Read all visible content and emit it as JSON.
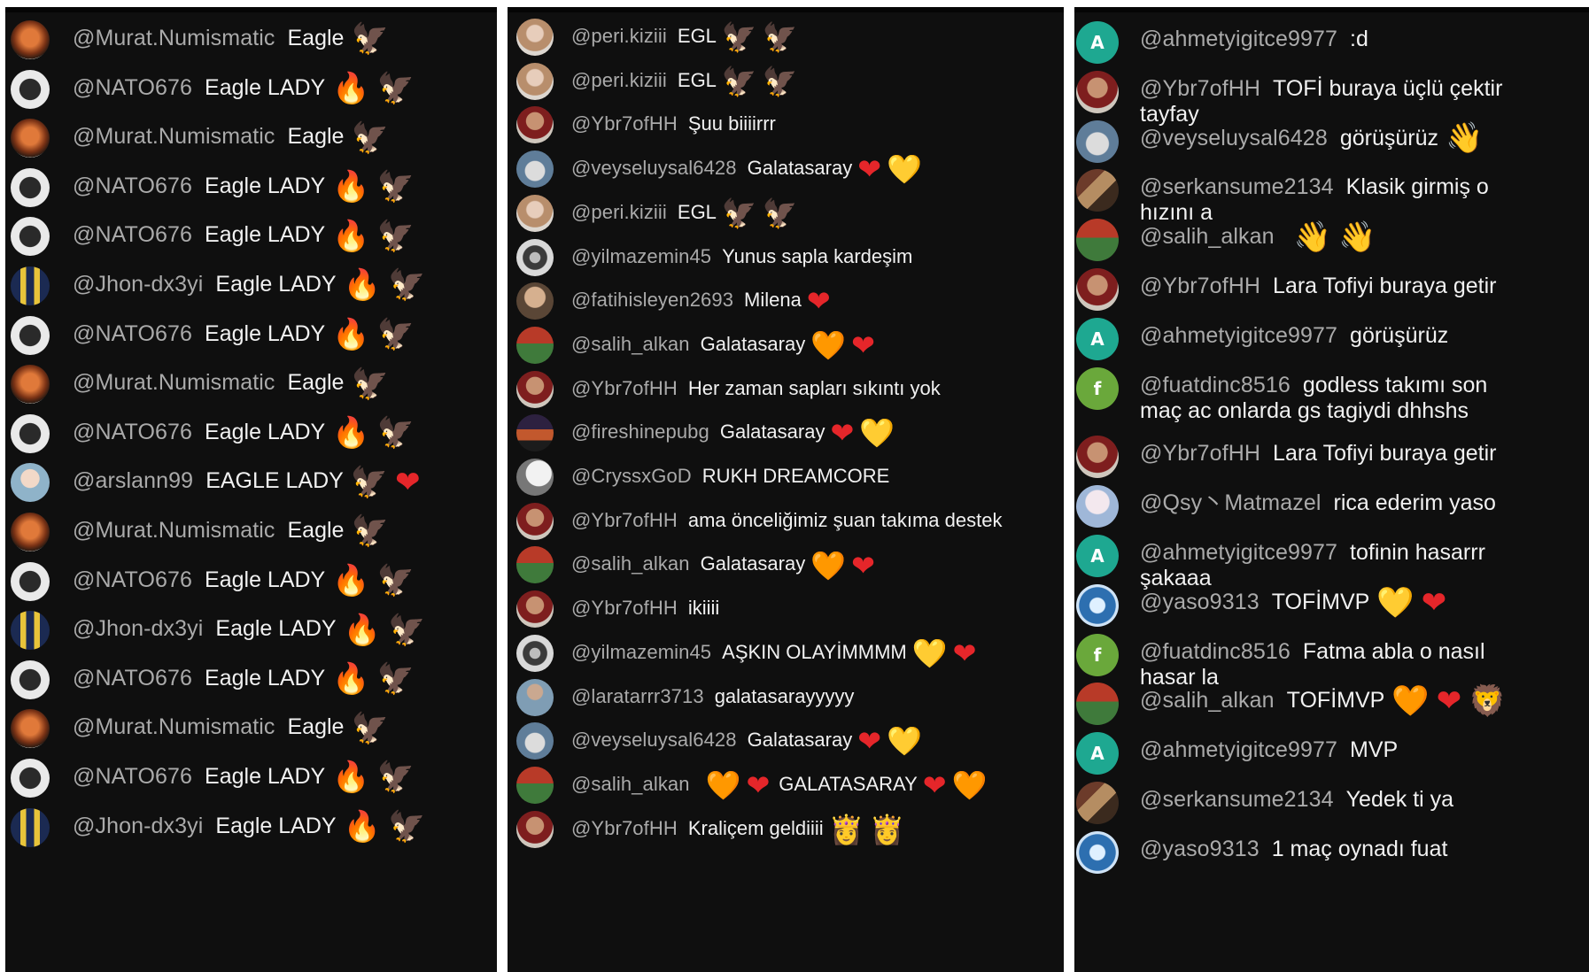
{
  "panels": [
    {
      "rows": [
        {
          "avatar": "murat",
          "user": "@Murat.Numismatic",
          "text": "Eagle",
          "emojis": [
            "eagle"
          ]
        },
        {
          "avatar": "nato",
          "user": "@NATO676",
          "text": "Eagle LADY",
          "emojis": [
            "fire",
            "eagle"
          ]
        },
        {
          "avatar": "murat",
          "user": "@Murat.Numismatic",
          "text": "Eagle",
          "emojis": [
            "eagle"
          ]
        },
        {
          "avatar": "nato",
          "user": "@NATO676",
          "text": "Eagle LADY",
          "emojis": [
            "fire",
            "eagle"
          ]
        },
        {
          "avatar": "nato",
          "user": "@NATO676",
          "text": "Eagle LADY",
          "emojis": [
            "fire",
            "eagle"
          ]
        },
        {
          "avatar": "jhon",
          "user": "@Jhon-dx3yi",
          "text": "Eagle LADY",
          "emojis": [
            "fire",
            "eagle"
          ]
        },
        {
          "avatar": "nato",
          "user": "@NATO676",
          "text": "Eagle LADY",
          "emojis": [
            "fire",
            "eagle"
          ]
        },
        {
          "avatar": "murat",
          "user": "@Murat.Numismatic",
          "text": "Eagle",
          "emojis": [
            "eagle"
          ]
        },
        {
          "avatar": "nato",
          "user": "@NATO676",
          "text": "Eagle LADY",
          "emojis": [
            "fire",
            "eagle"
          ]
        },
        {
          "avatar": "arslan",
          "user": "@arslann99",
          "text": "EAGLE LADY",
          "emojis": [
            "eagle",
            "red-heart"
          ]
        },
        {
          "avatar": "murat",
          "user": "@Murat.Numismatic",
          "text": "Eagle",
          "emojis": [
            "eagle"
          ]
        },
        {
          "avatar": "nato",
          "user": "@NATO676",
          "text": "Eagle LADY",
          "emojis": [
            "fire",
            "eagle"
          ]
        },
        {
          "avatar": "jhon",
          "user": "@Jhon-dx3yi",
          "text": "Eagle LADY",
          "emojis": [
            "fire",
            "eagle"
          ]
        },
        {
          "avatar": "nato",
          "user": "@NATO676",
          "text": "Eagle LADY",
          "emojis": [
            "fire",
            "eagle"
          ]
        },
        {
          "avatar": "murat",
          "user": "@Murat.Numismatic",
          "text": "Eagle",
          "emojis": [
            "eagle"
          ]
        },
        {
          "avatar": "nato",
          "user": "@NATO676",
          "text": "Eagle LADY",
          "emojis": [
            "fire",
            "eagle"
          ]
        },
        {
          "avatar": "jhon",
          "user": "@Jhon-dx3yi",
          "text": "Eagle LADY",
          "emojis": [
            "fire",
            "eagle"
          ]
        }
      ]
    },
    {
      "rows": [
        {
          "avatar": "peri",
          "user": "@peri.kiziii",
          "text": "EGL",
          "emojis": [
            "eagle",
            "eagle"
          ]
        },
        {
          "avatar": "peri",
          "user": "@peri.kiziii",
          "text": "EGL",
          "emojis": [
            "eagle",
            "eagle"
          ]
        },
        {
          "avatar": "ybr",
          "user": "@Ybr7ofHH",
          "text": "Şuu biiiirrr",
          "emojis": []
        },
        {
          "avatar": "veysel",
          "user": "@veyseluysal6428",
          "text": "Galatasaray",
          "emojis": [
            "red-heart",
            "yellow-heart"
          ]
        },
        {
          "avatar": "peri",
          "user": "@peri.kiziii",
          "text": "EGL",
          "emojis": [
            "eagle",
            "eagle"
          ]
        },
        {
          "avatar": "yilmaz",
          "user": "@yilmazemin45",
          "text": "Yunus sapla kardeşim",
          "emojis": []
        },
        {
          "avatar": "fatih",
          "user": "@fatihisleyen2693",
          "text": "Milena",
          "emojis": [
            "red-heart"
          ]
        },
        {
          "avatar": "salih",
          "user": "@salih_alkan",
          "text": "Galatasaray",
          "emojis": [
            "orange-heart",
            "red-heart"
          ]
        },
        {
          "avatar": "ybr",
          "user": "@Ybr7ofHH",
          "text": "Her zaman sapları sıkıntı yok",
          "emojis": []
        },
        {
          "avatar": "fire",
          "user": "@fireshinepubg",
          "text": "Galatasaray",
          "emojis": [
            "red-heart",
            "yellow-heart"
          ]
        },
        {
          "avatar": "cryss",
          "user": "@CryssxGoD",
          "text": "RUKH DREAMCORE",
          "emojis": []
        },
        {
          "avatar": "ybr",
          "user": "@Ybr7ofHH",
          "text": "ama önceliğimiz şuan takıma destek",
          "emojis": []
        },
        {
          "avatar": "salih",
          "user": "@salih_alkan",
          "text": "Galatasaray",
          "emojis": [
            "orange-heart",
            "red-heart"
          ]
        },
        {
          "avatar": "ybr",
          "user": "@Ybr7ofHH",
          "text": "ikiiii",
          "emojis": []
        },
        {
          "avatar": "yilmaz",
          "user": "@yilmazemin45",
          "text": "AŞKIN OLAYİMMMM",
          "emojis": [
            "yellow-heart",
            "red-heart"
          ]
        },
        {
          "avatar": "lara",
          "user": "@laratarrr3713",
          "text": "galatasarayyyyy",
          "emojis": []
        },
        {
          "avatar": "veysel",
          "user": "@veyseluysal6428",
          "text": "Galatasaray",
          "emojis": [
            "red-heart",
            "yellow-heart"
          ]
        },
        {
          "avatar": "salih",
          "user": "@salih_alkan",
          "text": "",
          "emojis": [
            "orange-heart",
            "red-heart"
          ],
          "text2": "GALATASARAY",
          "emojis2": [
            "red-heart",
            "orange-heart"
          ]
        },
        {
          "avatar": "ybr",
          "user": "@Ybr7ofHH",
          "text": "Kraliçem geldiiii",
          "emojis": [
            "crown",
            "crown"
          ]
        }
      ]
    },
    {
      "rows": [
        {
          "avatar": "letter-a",
          "avatar_letter": "A",
          "user": "@ahmetyigitce9977",
          "text": ":d",
          "emojis": []
        },
        {
          "avatar": "ybr",
          "user": "@Ybr7ofHH",
          "text": "TOFİ buraya üçlü çektir tayfay",
          "emojis": []
        },
        {
          "avatar": "veysel",
          "user": "@veyseluysal6428",
          "text": "görüşürüz",
          "emojis": [
            "wave"
          ]
        },
        {
          "avatar": "serkan",
          "user": "@serkansume2134",
          "text": "Klasik girmiş o hızını a",
          "emojis": []
        },
        {
          "avatar": "salih",
          "user": "@salih_alkan",
          "text": "",
          "emojis": [
            "wave",
            "wave"
          ]
        },
        {
          "avatar": "ybr",
          "user": "@Ybr7ofHH",
          "text": "Lara Tofiyi buraya getir",
          "emojis": []
        },
        {
          "avatar": "letter-a",
          "avatar_letter": "A",
          "user": "@ahmetyigitce9977",
          "text": "görüşürüz",
          "emojis": []
        },
        {
          "avatar": "letter-f",
          "avatar_letter": "f",
          "user": "@fuatdinc8516",
          "text": "godless takımı son maç ac onlarda gs tagiydi dhhshs",
          "emojis": []
        },
        {
          "avatar": "ybr",
          "user": "@Ybr7ofHH",
          "text": "Lara Tofiyi buraya getir",
          "emojis": []
        },
        {
          "avatar": "qsy",
          "user": "@Qsy丶Matmazel",
          "text": "rica ederim yaso",
          "emojis": []
        },
        {
          "avatar": "letter-a",
          "avatar_letter": "A",
          "user": "@ahmetyigitce9977",
          "text": "tofinin hasarrr şakaaa",
          "emojis": []
        },
        {
          "avatar": "yaso",
          "user": "@yaso9313",
          "text": "TOFİMVP",
          "emojis": [
            "yellow-heart",
            "red-heart"
          ]
        },
        {
          "avatar": "letter-f",
          "avatar_letter": "f",
          "user": "@fuatdinc8516",
          "text": "Fatma abla o nasıl hasar la",
          "emojis": []
        },
        {
          "avatar": "salih",
          "user": "@salih_alkan",
          "text": "TOFİMVP",
          "emojis": [
            "orange-heart",
            "red-heart",
            "lion"
          ]
        },
        {
          "avatar": "letter-a",
          "avatar_letter": "A",
          "user": "@ahmetyigitce9977",
          "text": "MVP",
          "emojis": []
        },
        {
          "avatar": "serkan",
          "user": "@serkansume2134",
          "text": "Yedek ti ya",
          "emojis": []
        },
        {
          "avatar": "yaso",
          "user": "@yaso9313",
          "text": "1 maç oynadı fuat",
          "emojis": []
        }
      ]
    }
  ],
  "emoji_glyphs": {
    "eagle": "🦅",
    "fire": "🔥",
    "red-heart": "❤",
    "yellow-heart": "💛",
    "orange-heart": "🧡",
    "wave": "👋",
    "crown": "👸",
    "lion": "🦁"
  },
  "colors": {
    "panel_bg": "#0f0f0f",
    "username": "#aaaaaa",
    "message": "#f1f1f1",
    "avatar_a": "#1ea891",
    "avatar_f": "#6aa83b"
  }
}
